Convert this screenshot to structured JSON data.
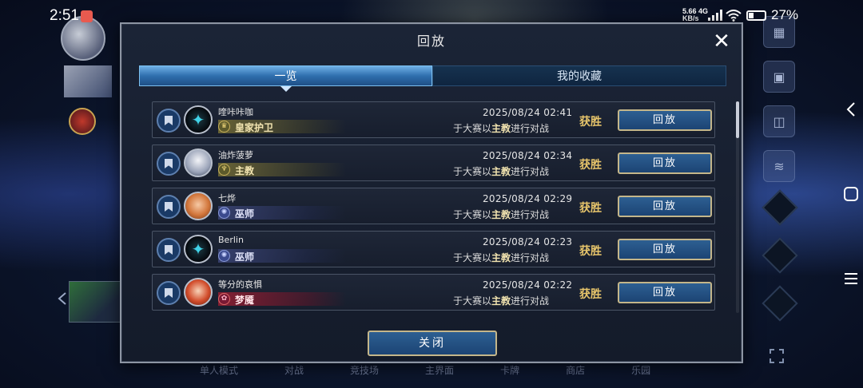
{
  "status_bar": {
    "time": "2:51",
    "net_speed": "5.66",
    "net_unit": "KB/s",
    "net_type": "4G",
    "battery_pct": "27%"
  },
  "background": {
    "bottom_nav": [
      "单人模式",
      "对战",
      "竞技场",
      "主界面",
      "卡牌",
      "商店",
      "乐园"
    ]
  },
  "modal": {
    "title": "回放",
    "close_icon": "✕",
    "tabs": [
      {
        "label": "一览",
        "active": true
      },
      {
        "label": "我的收藏",
        "active": false
      }
    ],
    "rows": [
      {
        "player": "喹咔咔咖",
        "class": "皇家护卫",
        "class_style": "gold",
        "class_glyph": "♛",
        "avatar_style": "dark",
        "date": "2025/08/24  02:41",
        "desc_pre": "于大赛以",
        "desc_class": "主教",
        "desc_post": "进行对战",
        "result": "获胜",
        "button": "回放"
      },
      {
        "player": "油炸菠萝",
        "class": "主教",
        "class_style": "gold",
        "class_glyph": "♆",
        "avatar_style": "white",
        "date": "2025/08/24  02:34",
        "desc_pre": "于大赛以",
        "desc_class": "主教",
        "desc_post": "进行对战",
        "result": "获胜",
        "button": "回放"
      },
      {
        "player": "七烨",
        "class": "巫师",
        "class_style": "blue",
        "class_glyph": "✺",
        "avatar_style": "orange",
        "date": "2025/08/24  02:29",
        "desc_pre": "于大赛以",
        "desc_class": "主教",
        "desc_post": "进行对战",
        "result": "获胜",
        "button": "回放"
      },
      {
        "player": "Berlin",
        "class": "巫师",
        "class_style": "blue",
        "class_glyph": "✺",
        "avatar_style": "dark",
        "date": "2025/08/24  02:23",
        "desc_pre": "于大赛以",
        "desc_class": "主教",
        "desc_post": "进行对战",
        "result": "获胜",
        "button": "回放"
      },
      {
        "player": "等分的哀惧",
        "class": "梦魇",
        "class_style": "red",
        "class_glyph": "✿",
        "avatar_style": "red",
        "date": "2025/08/24  02:22",
        "desc_pre": "于大赛以",
        "desc_class": "主教",
        "desc_post": "进行对战",
        "result": "获胜",
        "button": "回放"
      }
    ],
    "close_button": "关闭"
  }
}
